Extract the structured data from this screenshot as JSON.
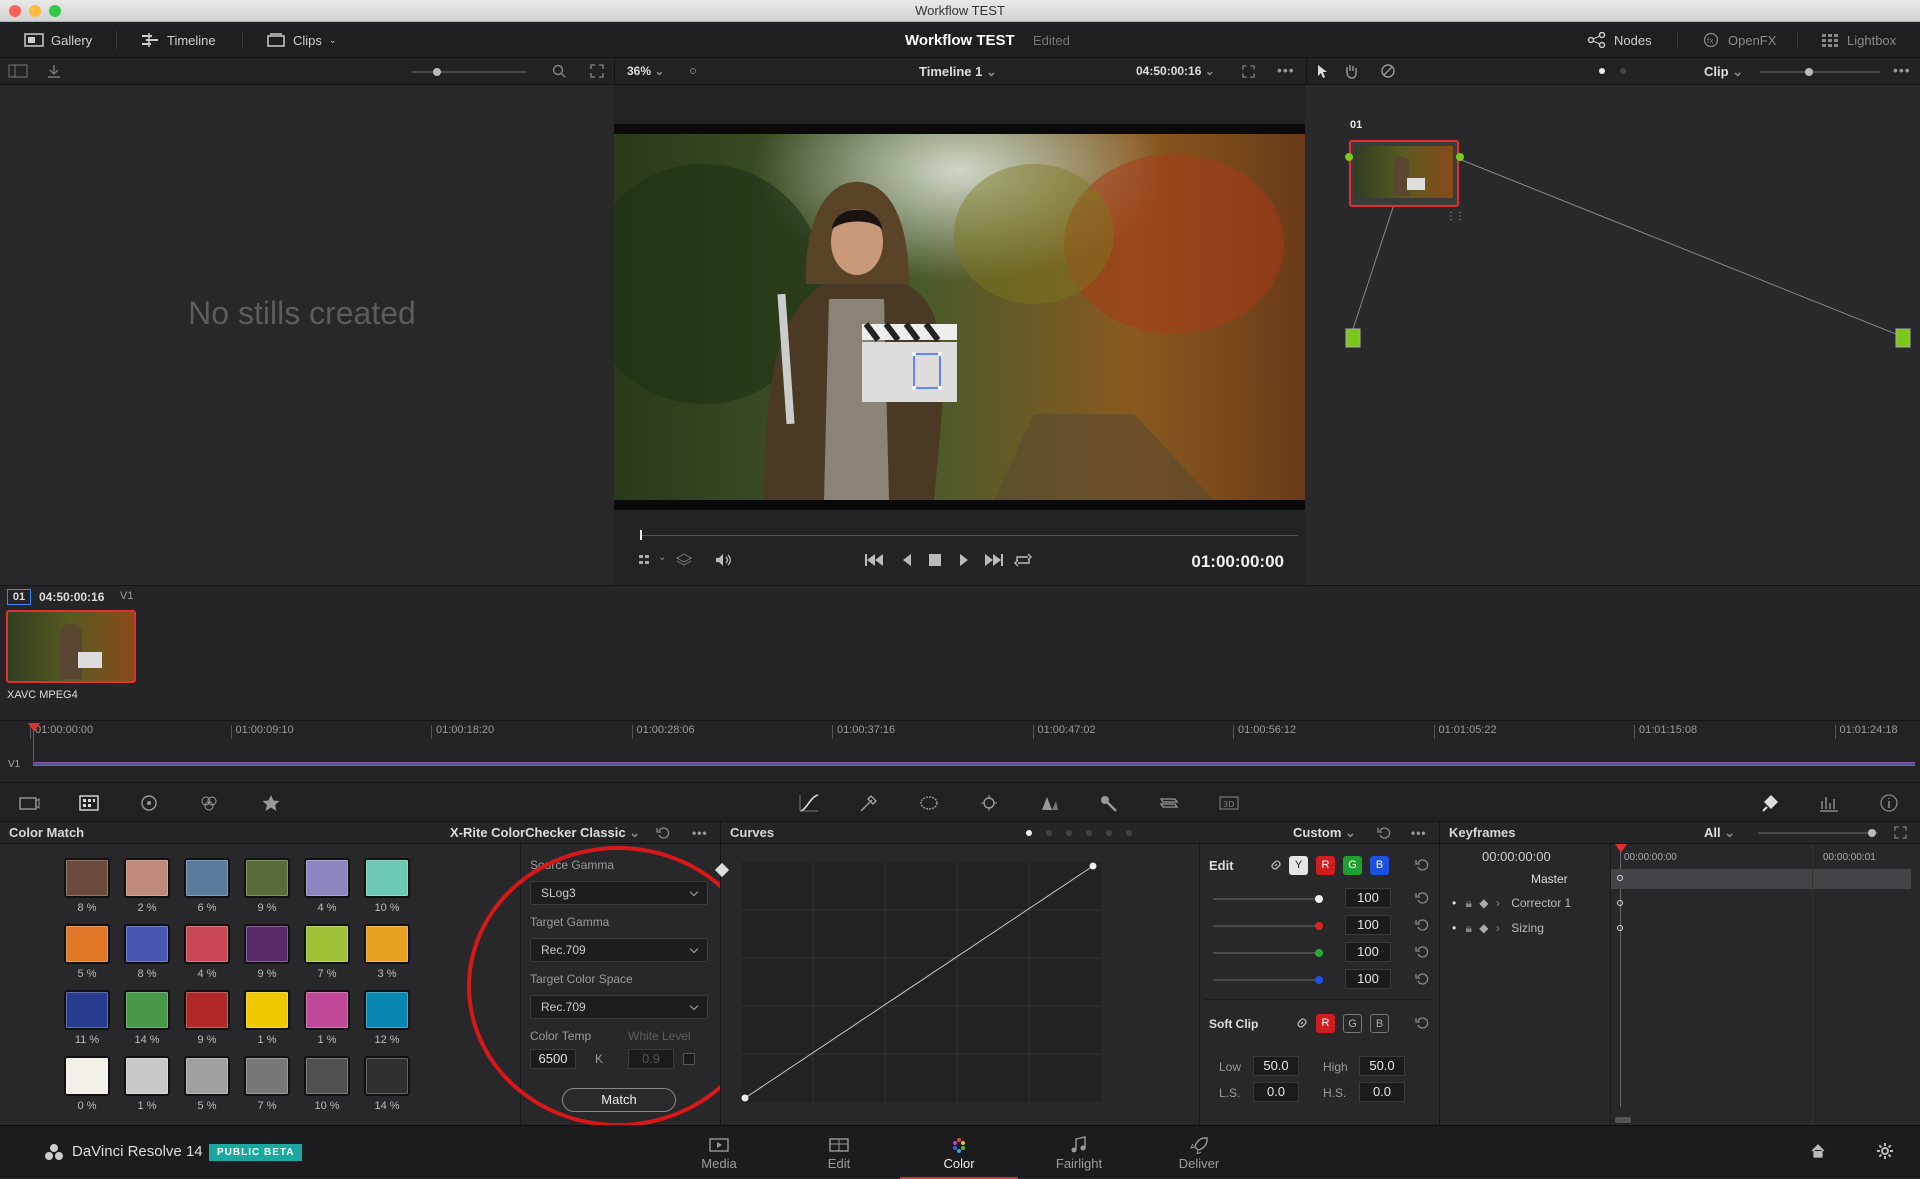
{
  "window": {
    "title": "Workflow TEST"
  },
  "topbar": {
    "gallery": "Gallery",
    "timeline": "Timeline",
    "clips": "Clips",
    "project": "Workflow TEST",
    "status": "Edited",
    "nodes": "Nodes",
    "openfx": "OpenFX",
    "lightbox": "Lightbox"
  },
  "viewer": {
    "zoom": "36%",
    "timeline_name": "Timeline 1",
    "timecode_top": "04:50:00:16",
    "clip_mode": "Clip",
    "timecode": "01:00:00:00"
  },
  "gallery": {
    "empty_message": "No stills created"
  },
  "node": {
    "label": "01"
  },
  "clip": {
    "index": "01",
    "timecode": "04:50:00:16",
    "track": "V1",
    "codec": "XAVC MPEG4"
  },
  "ruler": {
    "track": "V1",
    "ticks": [
      "01:00:00:00",
      "01:00:09:10",
      "01:00:18:20",
      "01:00:28:06",
      "01:00:37:16",
      "01:00:47:02",
      "01:00:56:12",
      "01:01:05:22",
      "01:01:15:08",
      "01:01:24:18"
    ]
  },
  "color_match": {
    "title": "Color Match",
    "chart": "X-Rite ColorChecker Classic",
    "swatches": [
      {
        "color": "#6b4a3e",
        "pct": "8 %"
      },
      {
        "color": "#c08a7a",
        "pct": "2 %"
      },
      {
        "color": "#5a7a9e",
        "pct": "6 %"
      },
      {
        "color": "#5a6a3a",
        "pct": "9 %"
      },
      {
        "color": "#8a86c0",
        "pct": "4 %"
      },
      {
        "color": "#6cc8b0",
        "pct": "10 %"
      },
      {
        "color": "#e07828",
        "pct": "5 %"
      },
      {
        "color": "#4858b0",
        "pct": "8 %"
      },
      {
        "color": "#c84858",
        "pct": "4 %"
      },
      {
        "color": "#5a2a6a",
        "pct": "9 %"
      },
      {
        "color": "#a0c038",
        "pct": "7 %"
      },
      {
        "color": "#e8a020",
        "pct": "3 %"
      },
      {
        "color": "#283c90",
        "pct": "11 %"
      },
      {
        "color": "#48984a",
        "pct": "14 %"
      },
      {
        "color": "#b02828",
        "pct": "9 %"
      },
      {
        "color": "#f0c800",
        "pct": "1 %"
      },
      {
        "color": "#c04898",
        "pct": "1 %"
      },
      {
        "color": "#0888b0",
        "pct": "12 %"
      },
      {
        "color": "#f2f0e8",
        "pct": "0 %"
      },
      {
        "color": "#c8c8c8",
        "pct": "1 %"
      },
      {
        "color": "#a0a0a0",
        "pct": "5 %"
      },
      {
        "color": "#787878",
        "pct": "7 %"
      },
      {
        "color": "#505050",
        "pct": "10 %"
      },
      {
        "color": "#303030",
        "pct": "14 %"
      }
    ],
    "source_gamma_label": "Source Gamma",
    "source_gamma": "SLog3",
    "target_gamma_label": "Target Gamma",
    "target_gamma": "Rec.709",
    "target_cs_label": "Target Color Space",
    "target_cs": "Rec.709",
    "color_temp_label": "Color Temp",
    "white_level_label": "White Level",
    "color_temp": "6500",
    "kelvin": "K",
    "white_level": "0.9",
    "match_button": "Match"
  },
  "curves": {
    "title": "Curves",
    "mode": "Custom",
    "edit": "Edit",
    "y": "Y",
    "r": "R",
    "g": "G",
    "b": "B",
    "values": [
      "100",
      "100",
      "100",
      "100"
    ],
    "soft_clip": "Soft Clip",
    "low_label": "Low",
    "low": "50.0",
    "high_label": "High",
    "high": "50.0",
    "ls_label": "L.S.",
    "ls": "0.0",
    "hs_label": "H.S.",
    "hs": "0.0"
  },
  "keyframes": {
    "title": "Keyframes",
    "filter": "All",
    "tc_left": "00:00:00:00",
    "tc_start": "00:00:00:00",
    "tc_end": "00:00:00:01",
    "master": "Master",
    "corrector": "Corrector 1",
    "sizing": "Sizing"
  },
  "footer": {
    "app": "DaVinci Resolve 14",
    "badge": "PUBLIC BETA",
    "pages": [
      "Media",
      "Edit",
      "Color",
      "Fairlight",
      "Deliver"
    ]
  },
  "colors": {
    "accent_red": "#e03030",
    "badge": "#1aa8a0",
    "match_circle": "#d81818"
  }
}
